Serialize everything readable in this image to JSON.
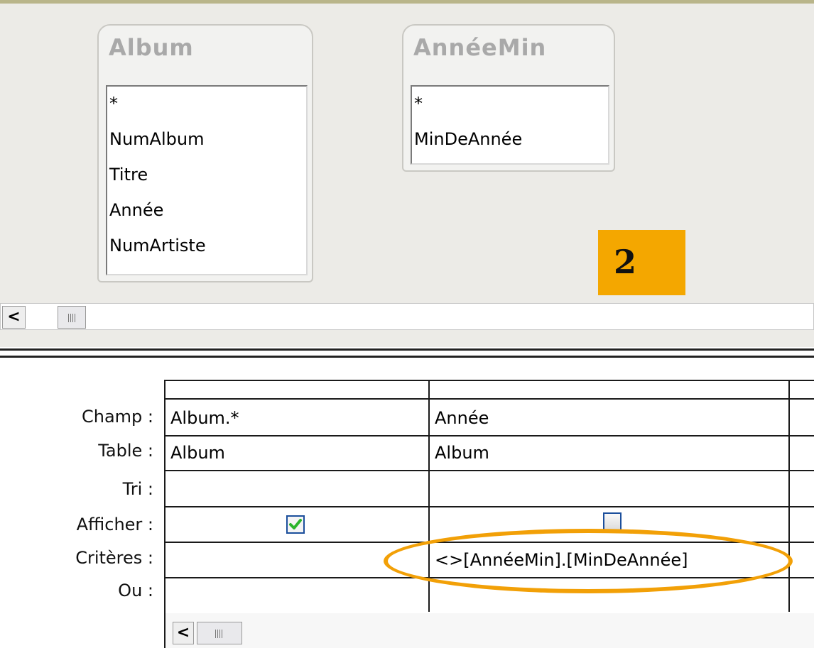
{
  "tables": [
    {
      "title": "Album",
      "fields": [
        "*",
        "NumAlbum",
        "Titre",
        "Année",
        "NumArtiste"
      ]
    },
    {
      "title": "AnnéeMin",
      "fields": [
        "*",
        "MinDeAnnée"
      ]
    }
  ],
  "badge": {
    "label": "2"
  },
  "grid": {
    "row_labels": [
      "Champ :",
      "Table :",
      "Tri :",
      "Afficher :",
      "Critères :",
      "Ou :"
    ],
    "columns": [
      {
        "champ": "Album.*",
        "table": "Album",
        "tri": "",
        "afficher": true,
        "criteres": "",
        "ou": ""
      },
      {
        "champ": "Année",
        "table": "Album",
        "tri": "",
        "afficher": false,
        "criteres": "<>[AnnéeMin].[MinDeAnnée]",
        "ou": ""
      }
    ]
  },
  "scroll_left_arrow": "<",
  "colors": {
    "badge": "#f4a700",
    "highlight": "#f2a007",
    "checkmark": "#2bb52b",
    "checkbox_border": "#1c4f9c"
  },
  "icons": [
    "scroll-left-arrow-icon",
    "scroll-thumb-grip-icon",
    "checkmark-icon"
  ]
}
